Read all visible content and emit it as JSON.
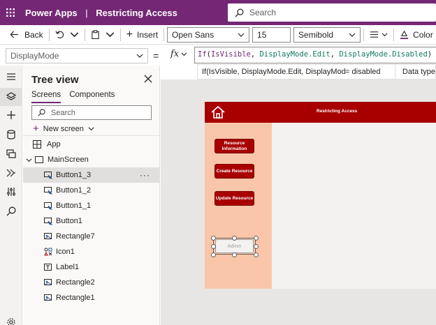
{
  "titlebar": {
    "app_name": "Power Apps",
    "separator": "|",
    "document_title": "Restricting Access",
    "search_placeholder": "Search"
  },
  "commandbar": {
    "back_label": "Back",
    "insert_label": "Insert",
    "font_family": "Open Sans",
    "font_size": "15",
    "font_weight": "Semibold",
    "color_label": "Color"
  },
  "formulabar": {
    "property": "DisplayMode",
    "equals": "=",
    "fx": "fx",
    "formula": {
      "fn": "If",
      "open": "(",
      "arg1": "IsVisible",
      "comma1": ", ",
      "arg2": "DisplayMode.Edit",
      "comma2": ", ",
      "arg3": "DisplayMode.Disabled",
      "close": ")"
    },
    "intellisense": {
      "expression": "If(IsVisible, DisplayMode.Edit, DisplayMode.Disabl...",
      "result": "=  disabled",
      "data_type_label": "Data type"
    }
  },
  "treeview": {
    "title": "Tree view",
    "tabs": [
      "Screens",
      "Components"
    ],
    "active_tab": "Screens",
    "search_placeholder": "Search",
    "new_screen_label": "New screen",
    "items": [
      {
        "label": "App",
        "icon": "app-icon",
        "indent": 0
      },
      {
        "label": "MainScreen",
        "icon": "screen-icon",
        "indent": 0
      },
      {
        "label": "Button1_3",
        "icon": "button-icon",
        "indent": 1,
        "selected": true
      },
      {
        "label": "Button1_2",
        "icon": "button-icon",
        "indent": 1
      },
      {
        "label": "Button1_1",
        "icon": "button-icon",
        "indent": 1
      },
      {
        "label": "Button1",
        "icon": "button-icon",
        "indent": 1
      },
      {
        "label": "Rectangle7",
        "icon": "rectangle-icon",
        "indent": 1
      },
      {
        "label": "Icon1",
        "icon": "icon-control-icon",
        "indent": 1
      },
      {
        "label": "Label1",
        "icon": "label-icon",
        "indent": 1
      },
      {
        "label": "Rectangle2",
        "icon": "rectangle-icon",
        "indent": 1
      },
      {
        "label": "Rectangle1",
        "icon": "rectangle-icon",
        "indent": 1
      }
    ],
    "more_label": "···"
  },
  "canvas": {
    "header_title": "Restricting Access",
    "buttons": [
      {
        "label": "Resource Information"
      },
      {
        "label": "Create Resource"
      },
      {
        "label": "Update Resource"
      }
    ],
    "admin_label": "Admin",
    "colors": {
      "header": "#a80000",
      "sidebar": "#f9c6a9",
      "button": "#a80000"
    }
  },
  "colors": {
    "brand": "#742774"
  }
}
